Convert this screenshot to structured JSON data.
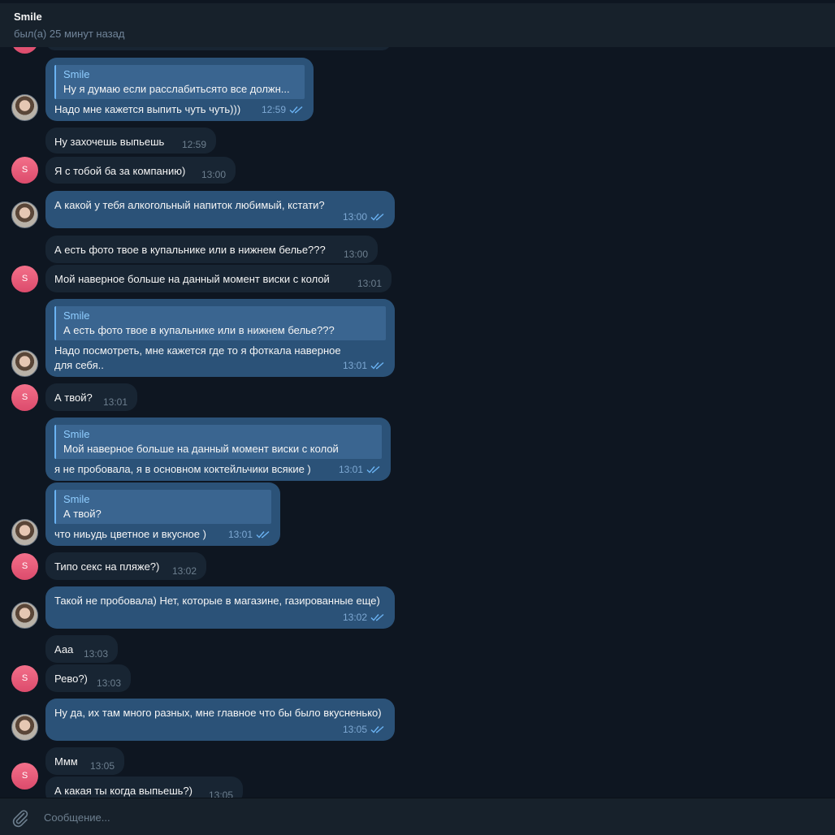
{
  "header": {
    "title": "Smile",
    "status": "был(а) 25 минут назад"
  },
  "avatars": {
    "contact_initial": "S"
  },
  "messages": [
    {
      "quote_name": "Smile",
      "quote_text": "Ну я думаю если расслабитьсято все должн...",
      "text": "Надо мне кажется выпить чуть чуть)))",
      "time": "12:59"
    },
    {
      "text": "Ну захочешь выпьешь",
      "time": "12:59"
    },
    {
      "text": "Я с тобой ба за компанию)",
      "time": "13:00"
    },
    {
      "text": "А какой у тебя алкогольный напиток любимый, кстати?",
      "time": "13:00"
    },
    {
      "text": "А есть фото твое в купальнике или в нижнем белье???",
      "time": "13:00"
    },
    {
      "text": "Мой наверное больше на данный момент виски с колой",
      "time": "13:01"
    },
    {
      "quote_name": "Smile",
      "quote_text": "А есть фото твое в купальнике или в нижнем белье???",
      "text": "Надо посмотреть, мне кажется где то я фоткала наверное для себя..",
      "time": "13:01"
    },
    {
      "text": "А твой?",
      "time": "13:01"
    },
    {
      "quote_name": "Smile",
      "quote_text": "Мой наверное больше на данный момент виски с колой",
      "text": "я не пробовала, я в основном коктейльчики всякие )",
      "time": "13:01"
    },
    {
      "quote_name": "Smile",
      "quote_text": "А твой?",
      "text": "что ниьудь цветное и вкусное )",
      "time": "13:01"
    },
    {
      "text": "Типо секс на пляже?)",
      "time": "13:02"
    },
    {
      "text": "Такой не пробовала) Нет, которые в магазине, газированные еще)",
      "time": "13:02"
    },
    {
      "text": "Ааа",
      "time": "13:03"
    },
    {
      "text": "Рево?)",
      "time": "13:03"
    },
    {
      "text": "Ну да, их там много разных, мне главное что бы было вкусненько)",
      "time": "13:05"
    },
    {
      "text": "Ммм",
      "time": "13:05"
    },
    {
      "text": "А какая ты когда выпьешь?)",
      "time": "13:05"
    }
  ],
  "composer": {
    "placeholder": "Сообщение..."
  },
  "icons": {
    "attach": "paperclip-icon",
    "read_receipt": "double-check-icon"
  }
}
